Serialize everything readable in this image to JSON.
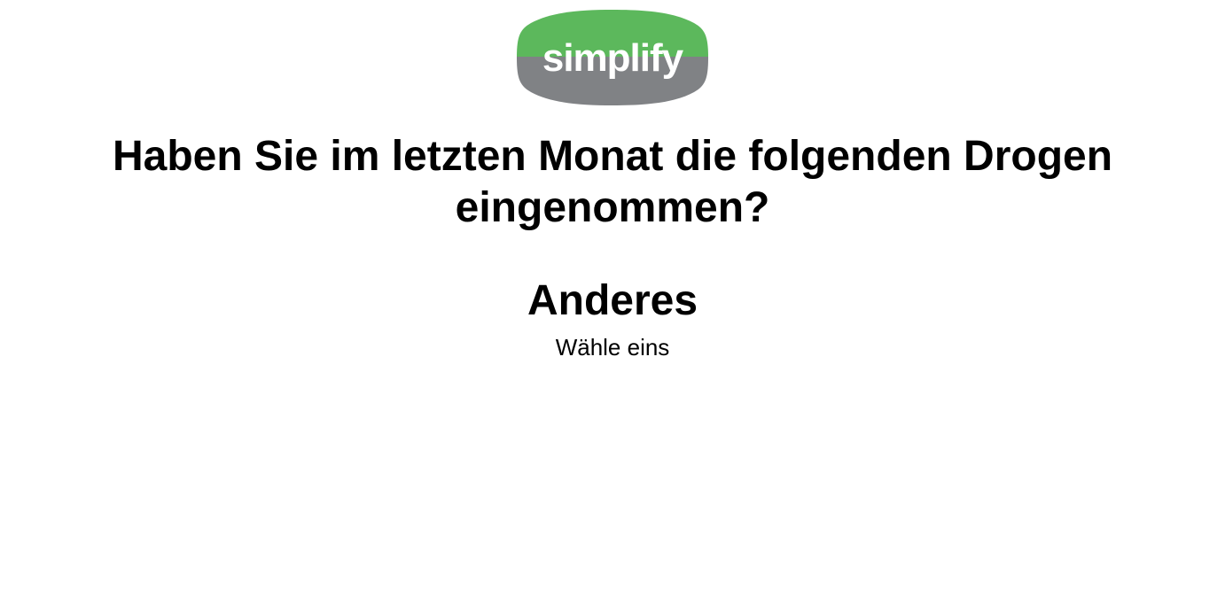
{
  "logo": {
    "text": "simplify",
    "colors": {
      "top": "#5cb85c",
      "bottom": "#808285",
      "text": "#ffffff"
    }
  },
  "question": {
    "text": "Haben Sie im letzten Monat die folgenden Drogen eingenommen?"
  },
  "item": {
    "title": "Anderes",
    "instruction": "Wähle eins"
  }
}
